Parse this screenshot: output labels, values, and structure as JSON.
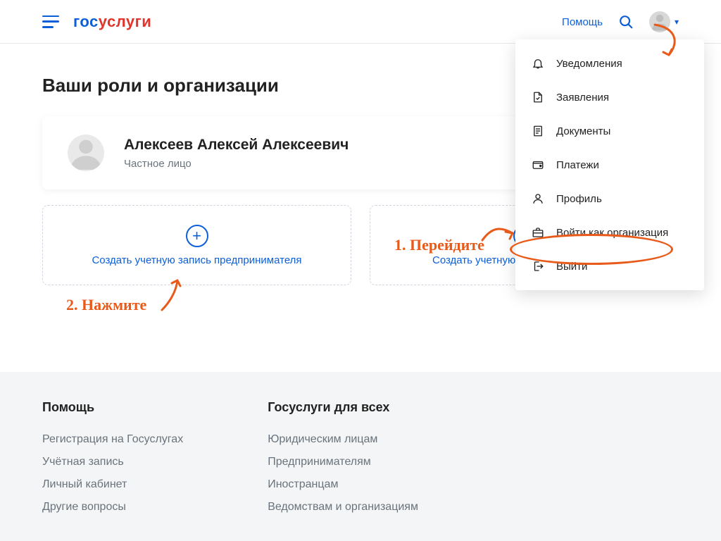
{
  "header": {
    "logo_b": "гос",
    "logo_r": "услуги",
    "help": "Помощь"
  },
  "page": {
    "title": "Ваши роли и организации",
    "user_name": "Алексеев Алексей Алексеевич",
    "user_subtitle": "Частное лицо"
  },
  "actions": {
    "left": "Создать учетную запись предпринимателя",
    "right": "Создать учетную запись организации"
  },
  "dropdown": [
    {
      "icon": "bell",
      "label": "Уведомления"
    },
    {
      "icon": "note",
      "label": "Заявления"
    },
    {
      "icon": "doc",
      "label": "Документы"
    },
    {
      "icon": "wallet",
      "label": "Платежи"
    },
    {
      "icon": "person",
      "label": "Профиль"
    },
    {
      "icon": "briefcase",
      "label": "Войти как организация"
    },
    {
      "icon": "logout",
      "label": "Выйти"
    }
  ],
  "footer": {
    "col1_title": "Помощь",
    "col1_links": [
      "Регистрация на Госуслугах",
      "Учётная запись",
      "Личный кабинет",
      "Другие вопросы"
    ],
    "col2_title": "Госуслуги для всех",
    "col2_links": [
      "Юридическим лицам",
      "Предпринимателям",
      "Иностранцам",
      "Ведомствам и организациям"
    ]
  },
  "annotations": {
    "step1": "1. Перейдите",
    "step2": "2. Нажмите"
  }
}
